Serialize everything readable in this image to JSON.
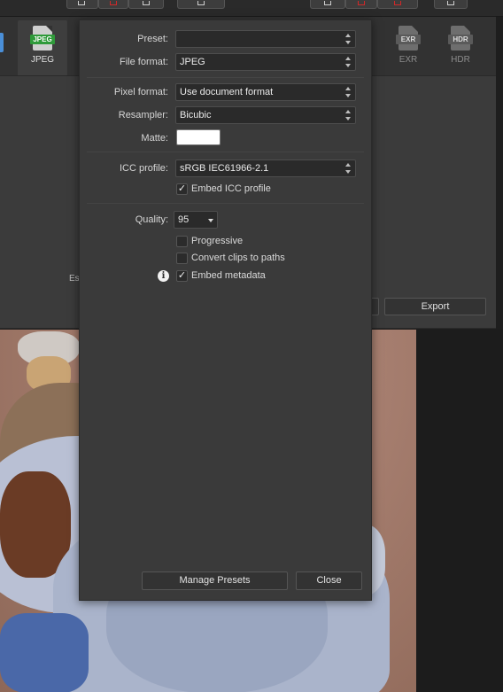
{
  "formats": {
    "jpeg": {
      "badge": "JPEG",
      "label": "JPEG",
      "badge_color": "#2f9a3a"
    },
    "exr": {
      "badge": "EXR",
      "label": "EXR"
    },
    "hdr": {
      "badge": "HDR",
      "label": "HDR"
    }
  },
  "export_window": {
    "truncated_text": "Es",
    "export_button": "Export"
  },
  "dialog": {
    "preset_label": "Preset:",
    "preset_value": "",
    "file_format_label": "File format:",
    "file_format_value": "JPEG",
    "pixel_format_label": "Pixel format:",
    "pixel_format_value": "Use document format",
    "resampler_label": "Resampler:",
    "resampler_value": "Bicubic",
    "matte_label": "Matte:",
    "matte_color": "#ffffff",
    "icc_label": "ICC profile:",
    "icc_value": "sRGB IEC61966-2.1",
    "embed_icc_label": "Embed ICC profile",
    "embed_icc_checked": true,
    "quality_label": "Quality:",
    "quality_value": "95",
    "progressive_label": "Progressive",
    "progressive_checked": false,
    "convert_clips_label": "Convert clips to paths",
    "convert_clips_checked": false,
    "embed_metadata_label": "Embed metadata",
    "embed_metadata_checked": true,
    "info_symbol": "i",
    "manage_presets_button": "Manage Presets",
    "close_button": "Close"
  },
  "colors": {
    "dialog_bg": "#3a3a3a",
    "field_bg": "#2a2a2a",
    "jpeg_badge": "#2f9a3a"
  }
}
